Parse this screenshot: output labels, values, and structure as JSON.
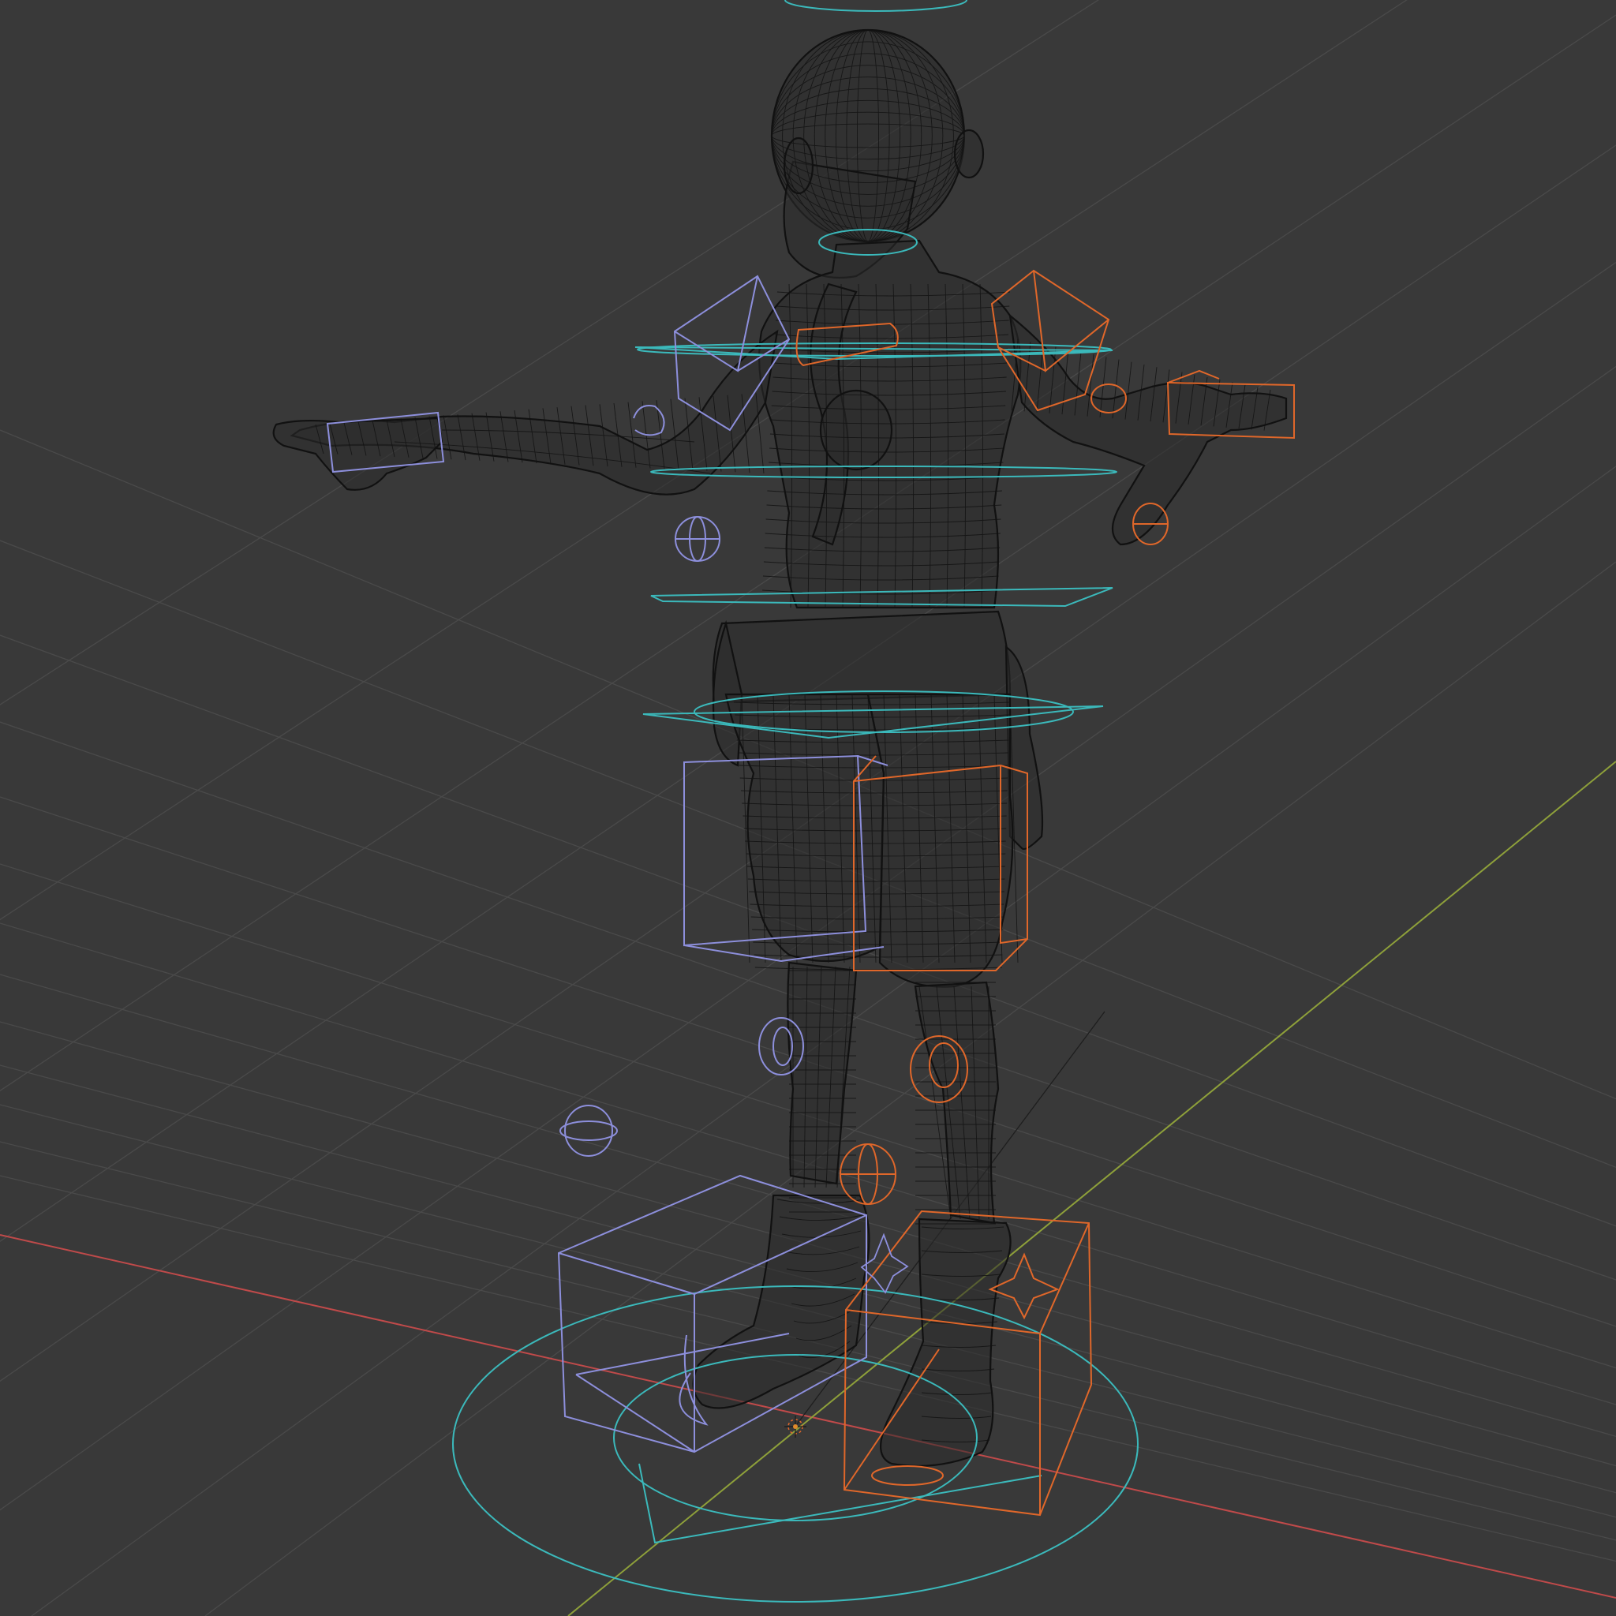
{
  "viewport": {
    "mode": "wireframe",
    "background_color": "#393939",
    "grid_color": "#4a4a4a",
    "x_axis_color": "#c04a4a",
    "y_axis_color": "#8ea03a",
    "mesh_color": "#121212",
    "control_colors": {
      "left_side": "#8d8fdc",
      "right_side": "#e0672a",
      "center": "#3bb9bb"
    },
    "icons": [
      "3d-cursor-icon",
      "origin-dot-icon"
    ]
  }
}
